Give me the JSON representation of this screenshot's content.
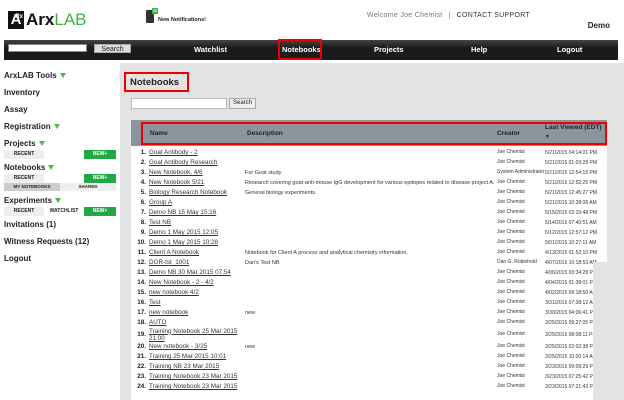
{
  "header": {
    "logo_mark": "A",
    "logo_sup": "Rx",
    "logo_text1": "Arx",
    "logo_text2": "LAB",
    "notif_count": "10",
    "notif_text": "New Notifications!",
    "welcome": "Welcome Joe Chemist",
    "sep": "|",
    "contact": "CONTACT SUPPORT",
    "company": "Demo"
  },
  "nav": {
    "search_label": "Search",
    "items": [
      "Watchlist",
      "Notebooks",
      "Projects",
      "Help",
      "Logout"
    ]
  },
  "sidebar": {
    "tools": "ArxLAB Tools",
    "inventory": "Inventory",
    "assay": "Assay",
    "registration": "Registration",
    "projects": "Projects",
    "notebooks": "Notebooks",
    "experiments": "Experiments",
    "recent": "RECENT",
    "watchlist": "WATCHLIST",
    "new": "NEW+",
    "my_notebooks": "MY NOTEBOOKS",
    "shared": "SHARED",
    "invitations": "Invitations (1)",
    "witness": "Witness Requests (12)",
    "logout": "Logout"
  },
  "main": {
    "title": "Notebooks",
    "search_label": "Search",
    "columns": {
      "name": "Name",
      "description": "Description",
      "creator": "Creator",
      "last_viewed": "Last Viewed (EDT)",
      "sort": "▼"
    },
    "rows": [
      {
        "n": "1.",
        "name": "Goat Antibody - 2",
        "desc": "",
        "creator": "Joe Chemist",
        "date": "5/21/2015 04:14:01 PM"
      },
      {
        "n": "2.",
        "name": "Goat Antibody Research",
        "desc": "",
        "creator": "Joe Chemist",
        "date": "5/21/2015 01:03:28 PM"
      },
      {
        "n": "3.",
        "name": "New Notebook, 4/6",
        "desc": "For Goat study",
        "creator": "System Administrator",
        "date": "5/21/2015 12:54:15 PM"
      },
      {
        "n": "4.",
        "name": "New Notebook 5/21",
        "desc": "Research covering goat-anti-mouse IgG development for various epitopes related to disease project A.",
        "creator": "Joe Chemist",
        "date": "5/21/2015 12:52:25 PM"
      },
      {
        "n": "5.",
        "name": "Biology Research Notebook",
        "desc": "General biology experiments.",
        "creator": "Joe Chemist",
        "date": "5/21/2015 12:45:27 PM"
      },
      {
        "n": "6.",
        "name": "Group A",
        "desc": "",
        "creator": "Joe Chemist",
        "date": "5/21/2015 10:28:08 AM"
      },
      {
        "n": "7.",
        "name": "Demo NB 15 May 15:16",
        "desc": "",
        "creator": "Joe Chemist",
        "date": "5/15/2015 03:15:48 PM"
      },
      {
        "n": "8.",
        "name": "Test NB",
        "desc": "",
        "creator": "Joe Chemist",
        "date": "5/14/2015 07:40:51 AM"
      },
      {
        "n": "9.",
        "name": "Demo 1 May 2015 12:05",
        "desc": "",
        "creator": "Joe Chemist",
        "date": "5/12/2015 12:57:12 PM"
      },
      {
        "n": "10.",
        "name": "Demo 1 May 2015 10:28",
        "desc": "",
        "creator": "Joe Chemist",
        "date": "5/01/2015 10:27:11 AM"
      },
      {
        "n": "11.",
        "name": "Client A Notebook",
        "desc": "Notebook for Client A process and analytical chemistry information.",
        "creator": "Joe Chemist",
        "date": "4/13/2015 01:52:10 PM"
      },
      {
        "n": "12.",
        "name": "DGR-tst_1001",
        "desc": "Dan's Test NB",
        "creator": "Dan G. Robinhold",
        "date": "4/07/2015 10:18:53 AM"
      },
      {
        "n": "13.",
        "name": "Demo NB 30 Mar 2015 07:54",
        "desc": "",
        "creator": "Joe Chemist",
        "date": "4/06/2015 03:34:28 PM"
      },
      {
        "n": "14.",
        "name": "New Notebook - 2 - 4/2",
        "desc": "",
        "creator": "Joe Chemist",
        "date": "4/04/2015 01:38:01 PM"
      },
      {
        "n": "15.",
        "name": "new notebook 4/2",
        "desc": "",
        "creator": "Joe Chemist",
        "date": "4/02/2015 09:18:50 AM"
      },
      {
        "n": "16.",
        "name": "Test",
        "desc": "",
        "creator": "Joe Chemist",
        "date": "3/31/2015 07:38:12 AM"
      },
      {
        "n": "17.",
        "name": "new notebook",
        "desc": "new",
        "creator": "Joe Chemist",
        "date": "3/30/2015 04:06:41 PM"
      },
      {
        "n": "18.",
        "name": "AUTO",
        "desc": "",
        "creator": "Joe Chemist",
        "date": "3/25/2015 09:27:05 PM"
      },
      {
        "n": "19.",
        "name": "Training Notebook 25 Mar 2015 21:00",
        "desc": "",
        "creator": "Joe Chemist",
        "date": "3/25/2015 08:08:11 PM"
      },
      {
        "n": "20.",
        "name": "New notebook - 3/25",
        "desc": "new",
        "creator": "Joe Chemist",
        "date": "3/25/2015 02:02:38 PM"
      },
      {
        "n": "21.",
        "name": "Training 25 Mar 2015 10:01",
        "desc": "",
        "creator": "Joe Chemist",
        "date": "3/25/2015 10:00:14 AM"
      },
      {
        "n": "22.",
        "name": "Training NB 23 Mar 2015",
        "desc": "",
        "creator": "Joe Chemist",
        "date": "3/23/2015 09:09:29 PM"
      },
      {
        "n": "23.",
        "name": "Training Notebook 23 Mar 2015",
        "desc": "",
        "creator": "Joe Chemist",
        "date": "3/23/2015 07:25:42 PM"
      },
      {
        "n": "24.",
        "name": "Training Notebook 23 Mar 2015",
        "desc": "",
        "creator": "Joe Chemist",
        "date": "3/23/2015 07:21:43 PM"
      }
    ]
  }
}
